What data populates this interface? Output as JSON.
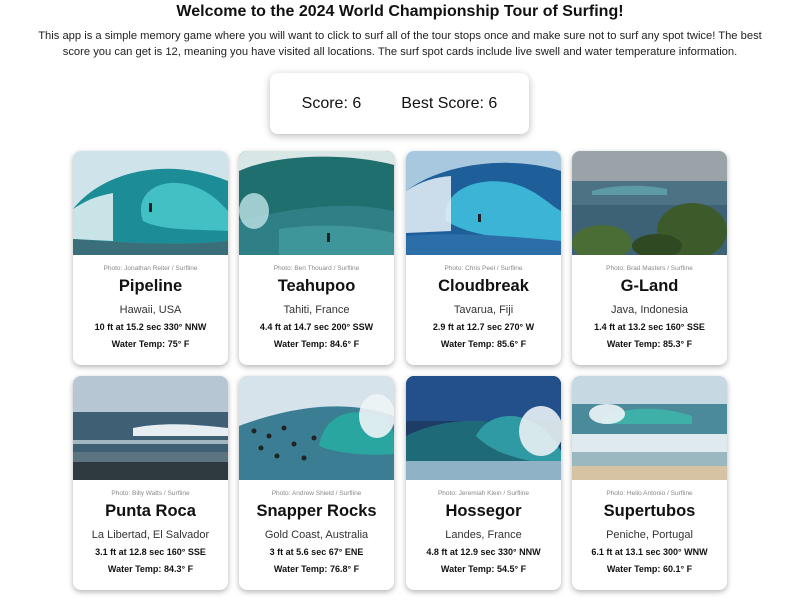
{
  "header": {
    "title": "Welcome to the 2024 World Championship Tour of Surfing!",
    "intro": "This app is a simple memory game where you will want to click to surf all of the tour stops once and make sure not to surf any spot twice! The best score you can get is 12, meaning you have visited all locations. The surf spot cards include live swell and water temperature information."
  },
  "scoreboard": {
    "score_label": "Score:",
    "score_value": "6",
    "best_label": "Best Score:",
    "best_value": "6"
  },
  "water_temp_label": "Water Temp:",
  "spots": [
    {
      "name": "Pipeline",
      "location": "Hawaii, USA",
      "credit": "Photo: Jonathan Reiter / Surfline",
      "swell": "10 ft at 15.2 sec 330° NNW",
      "temp": "75° F",
      "photo_icon": "barrel-wave-photo"
    },
    {
      "name": "Teahupoo",
      "location": "Tahiti, France",
      "credit": "Photo: Ben Thouard / Surfline",
      "swell": "4.4 ft at 14.7 sec 200° SSW",
      "temp": "84.6° F",
      "photo_icon": "heavy-wave-photo"
    },
    {
      "name": "Cloudbreak",
      "location": "Tavarua, Fiji",
      "credit": "Photo: Chris Peel / Surfline",
      "swell": "2.9 ft at 12.7 sec 270° W",
      "temp": "85.6° F",
      "photo_icon": "blue-barrel-photo"
    },
    {
      "name": "G-Land",
      "location": "Java, Indonesia",
      "credit": "Photo: Brad Masters / Surfline",
      "swell": "1.4 ft at 13.2 sec 160° SSE",
      "temp": "85.3° F",
      "photo_icon": "jungle-lineup-photo"
    },
    {
      "name": "Punta Roca",
      "location": "La Libertad, El Salvador",
      "credit": "Photo: Billy Watts / Surfline",
      "swell": "3.1 ft at 12.8 sec 160° SSE",
      "temp": "84.3° F",
      "photo_icon": "point-break-photo"
    },
    {
      "name": "Snapper Rocks",
      "location": "Gold Coast, Australia",
      "credit": "Photo: Andrew Shield / Surfline",
      "swell": "3 ft at 5.6 sec 67° ENE",
      "temp": "76.8° F",
      "photo_icon": "crowded-lineup-photo"
    },
    {
      "name": "Hossegor",
      "location": "Landes, France",
      "credit": "Photo: Jeremiah Klein / Surfline",
      "swell": "4.8 ft at 12.9 sec 330° NNW",
      "temp": "54.5° F",
      "photo_icon": "beach-break-photo"
    },
    {
      "name": "Supertubos",
      "location": "Peniche, Portugal",
      "credit": "Photo: Helio Antonio / Surfline",
      "swell": "6.1 ft at 13.1 sec 300° WNW",
      "temp": "60.1° F",
      "photo_icon": "shorebreak-photo"
    }
  ]
}
